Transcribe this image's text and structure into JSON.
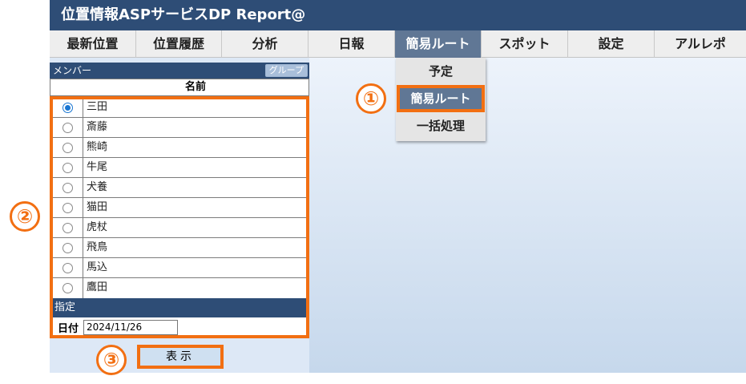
{
  "app": {
    "title": "位置情報ASPサービスDP Report@"
  },
  "nav": {
    "items": [
      {
        "label": "最新位置",
        "width": 108
      },
      {
        "label": "位置履歴",
        "width": 107
      },
      {
        "label": "分析",
        "width": 108
      },
      {
        "label": "日報",
        "width": 108
      },
      {
        "label": "簡易ルート",
        "width": 108,
        "active": true
      },
      {
        "label": "スポット",
        "width": 108
      },
      {
        "label": "設定",
        "width": 108
      },
      {
        "label": "アルレポ",
        "width": 114
      }
    ]
  },
  "dropdown": {
    "items": [
      "予定",
      "簡易ルート",
      "一括処理"
    ]
  },
  "sidebar": {
    "member_label": "メンバー",
    "group_button": "グループ",
    "name_header": "名前",
    "members": [
      {
        "name": "三田",
        "selected": true
      },
      {
        "name": "斎藤",
        "selected": false
      },
      {
        "name": "熊崎",
        "selected": false
      },
      {
        "name": "牛尾",
        "selected": false
      },
      {
        "name": "犬養",
        "selected": false
      },
      {
        "name": "猫田",
        "selected": false
      },
      {
        "name": "虎杖",
        "selected": false
      },
      {
        "name": "飛鳥",
        "selected": false
      },
      {
        "name": "馬込",
        "selected": false
      },
      {
        "name": "鷹田",
        "selected": false
      }
    ],
    "spec_label": "指定",
    "date_label": "日付",
    "date_value": "2024/11/26",
    "show_button": "表示"
  },
  "callouts": [
    "①",
    "②",
    "③"
  ],
  "colors": {
    "header": "#2e4d76",
    "accent": "#f26f12",
    "active": "#607795"
  }
}
